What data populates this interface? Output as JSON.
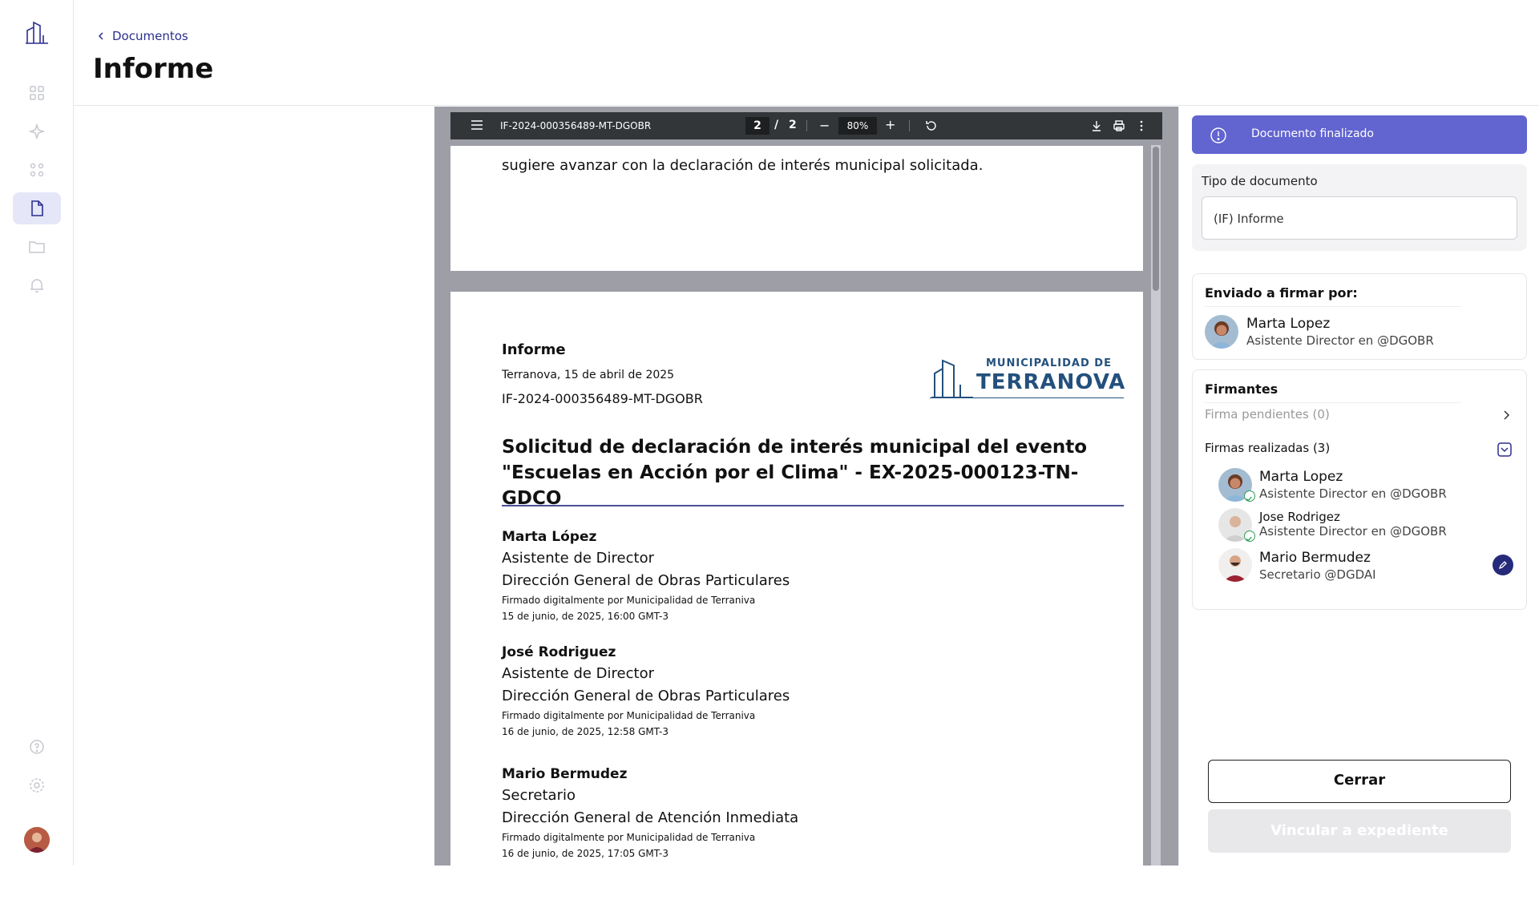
{
  "breadcrumb": {
    "label": "Documentos"
  },
  "page": {
    "title": "Informe"
  },
  "viewer": {
    "file_name": "IF-2024-000356489-MT-DGOBR",
    "current_page": "2",
    "page_separator": "/",
    "total_pages": "2",
    "zoom": "80%",
    "zoom_minus": "−",
    "zoom_plus": "+"
  },
  "document": {
    "page1_text": "sugiere avanzar con la declaración de interés municipal solicitada.",
    "heading": "Informe",
    "place_date": "Terranova, 15 de abril de 2025",
    "doc_id": "IF-2024-000356489-MT-DGOBR",
    "logo_line1": "MUNICIPALIDAD DE",
    "logo_line2": "TERRANOVA",
    "subject": "Solicitud de declaración de interés municipal del evento \"Escuelas en Acción por el Clima\" - EX-2025-000123-TN-GDCO",
    "signatures": [
      {
        "name": "Marta López",
        "role": "Asistente de Director",
        "dept": "Dirección General de Obras Particulares",
        "signed_by": "Firmado digitalmente por Municipalidad de Terraniva",
        "datetime": "15 de junio, de 2025, 16:00 GMT-3"
      },
      {
        "name": "José Rodriguez",
        "role": "Asistente de Director",
        "dept": "Dirección General de Obras Particulares",
        "signed_by": "Firmado digitalmente por Municipalidad de Terraniva",
        "datetime": "16 de junio, de 2025, 12:58 GMT-3"
      },
      {
        "name": "Mario Bermudez",
        "role": "Secretario",
        "dept": "Dirección General de Atención Inmediata",
        "signed_by": "Firmado digitalmente por Municipalidad de Terraniva",
        "datetime": "16 de junio, de 2025, 17:05 GMT-3"
      }
    ]
  },
  "sidebar": {
    "status": "Documento finalizado",
    "doc_type_label": "Tipo de documento",
    "doc_type_value": "(IF) Informe",
    "sent_by_title": "Enviado a firmar por:",
    "sender": {
      "name": "Marta Lopez",
      "role": "Asistente Director en @DGOBR"
    },
    "signers_title": "Firmantes",
    "pending_label": "Firma pendientes (0)",
    "done_label": "Firmas realizadas (3)",
    "signers": [
      {
        "name": "Marta Lopez",
        "role": "Asistente Director en @DGOBR"
      },
      {
        "name": "Jose Rodrigez",
        "role": "Asistente Director en @DGOBR"
      },
      {
        "name": "Mario Bermudez",
        "role": "Secretario @DGDAI"
      }
    ],
    "close_button": "Cerrar",
    "link_button": "Vincular a expediente"
  },
  "colors": {
    "accent": "#6264d0",
    "brand": "#2b2f8f",
    "logo": "#23507d",
    "success": "#2e9d57"
  }
}
